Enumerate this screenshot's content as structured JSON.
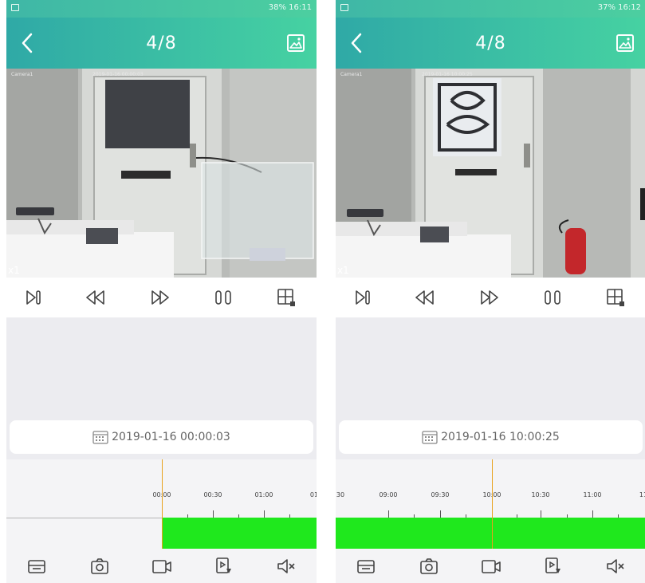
{
  "screens": [
    {
      "status": {
        "text": "38% 16:11"
      },
      "title": "4/8",
      "osd": {
        "camera": "Camera1",
        "time": "2019-01-16 00:00:03"
      },
      "speed": "x1",
      "date": "2019-01-16 00:00:03",
      "timeline": {
        "labels": [
          "00:00",
          "00:30",
          "01:00",
          "01"
        ]
      }
    },
    {
      "status": {
        "text": "37% 16:12"
      },
      "title": "4/8",
      "osd": {
        "camera": "Camera1",
        "time": "2019-01-16 10:00:25"
      },
      "speed": "x1",
      "date": "2019-01-16 10:00:25",
      "timeline": {
        "labels": [
          "30",
          "09:00",
          "09:30",
          "10:00",
          "10:30",
          "11:00",
          "11"
        ]
      }
    }
  ],
  "icons": {
    "back": "chevron-left-icon",
    "gallery": "gallery-icon",
    "controls": [
      "frame-step-icon",
      "rewind-icon",
      "fast-forward-icon",
      "pause-icon",
      "layout-grid-icon"
    ],
    "bottom": [
      "storage-icon",
      "camera-icon",
      "video-record-icon",
      "playback-file-icon",
      "mute-icon"
    ]
  },
  "colors": {
    "header_start": "#2fa9a6",
    "header_end": "#46d2a2",
    "record_bar": "#1fe81d",
    "cursor": "#e8a21b"
  }
}
